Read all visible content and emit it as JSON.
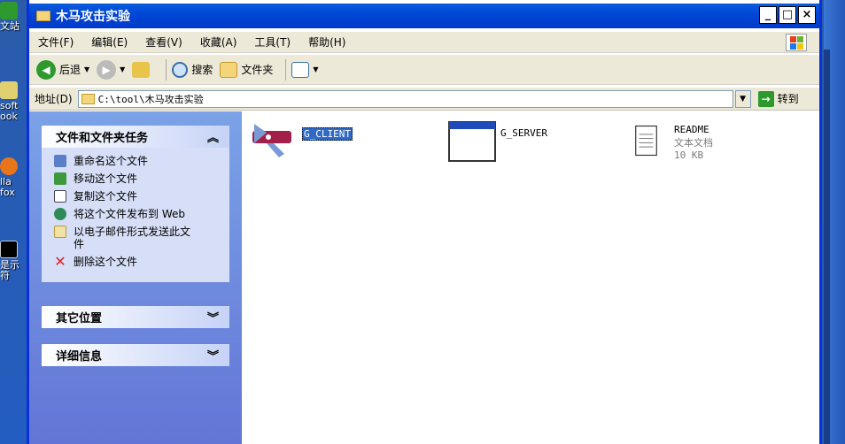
{
  "desktop": {
    "icons": [
      {
        "label": "文站"
      },
      {
        "label": "soft\nook"
      },
      {
        "label": "lla\nfox"
      },
      {
        "label": "是示符"
      }
    ]
  },
  "window": {
    "title": "木马攻击实验",
    "controls": {
      "minimize": "_",
      "maximize": "□",
      "close": "×"
    }
  },
  "menu": {
    "items": [
      "文件(F)",
      "编辑(E)",
      "查看(V)",
      "收藏(A)",
      "工具(T)",
      "帮助(H)"
    ]
  },
  "toolbar": {
    "back_label": "后退",
    "search_label": "搜索",
    "folders_label": "文件夹"
  },
  "address": {
    "label": "地址(D)",
    "value": "C:\\tool\\木马攻击实验",
    "go_label": "转到"
  },
  "taskpane": {
    "file_tasks": {
      "title": "文件和文件夹任务",
      "items": [
        {
          "label": "重命名这个文件",
          "icon": "rename-icon"
        },
        {
          "label": "移动这个文件",
          "icon": "move-icon"
        },
        {
          "label": "复制这个文件",
          "icon": "copy-icon"
        },
        {
          "label": "将这个文件发布到 Web",
          "icon": "web-publish-icon"
        },
        {
          "label": "以电子邮件形式发送此文件",
          "icon": "email-icon"
        },
        {
          "label": "删除这个文件",
          "icon": "delete-icon"
        }
      ]
    },
    "other_places": {
      "title": "其它位置"
    },
    "details": {
      "title": "详细信息"
    }
  },
  "files": [
    {
      "name": "G_CLIENT",
      "selected": true,
      "icon": "trojan-client-icon"
    },
    {
      "name": "G_SERVER",
      "selected": false,
      "icon": "application-window-icon"
    },
    {
      "name": "README",
      "type": "文本文档",
      "size": "10 KB",
      "icon": "text-document-icon"
    }
  ],
  "colors": {
    "titlebar": "#0a5ddd",
    "taskpane": "#6f8fe0",
    "selection": "#316ac5"
  }
}
